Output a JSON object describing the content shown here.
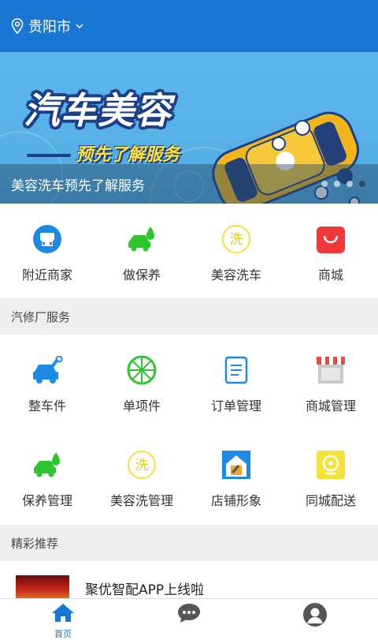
{
  "header": {
    "city": "贵阳市"
  },
  "banner": {
    "title": "汽车美容",
    "subtitle": "预先了解服务",
    "caption": "美容洗车预先了解服务",
    "dots": 4,
    "active_dot": 4
  },
  "quick_menu": [
    {
      "label": "附近商家",
      "icon": "nearby-shop-icon"
    },
    {
      "label": "做保养",
      "icon": "maintenance-icon"
    },
    {
      "label": "美容洗车",
      "icon": "car-wash-icon"
    },
    {
      "label": "商城",
      "icon": "mall-bag-icon"
    }
  ],
  "service_section": {
    "title": "汽修厂服务"
  },
  "services": [
    {
      "label": "整车件",
      "icon": "car-repair-icon"
    },
    {
      "label": "单项件",
      "icon": "wheel-icon"
    },
    {
      "label": "订单管理",
      "icon": "order-doc-icon"
    },
    {
      "label": "商城管理",
      "icon": "store-icon"
    },
    {
      "label": "保养管理",
      "icon": "maintenance-icon"
    },
    {
      "label": "美容洗管理",
      "icon": "car-wash-icon"
    },
    {
      "label": "店铺形象",
      "icon": "shop-image-icon"
    },
    {
      "label": "同城配送",
      "icon": "delivery-icon"
    }
  ],
  "recommend_section": {
    "title": "精彩推荐"
  },
  "news": [
    {
      "title": "聚优智配APP上线啦"
    }
  ],
  "tabbar": [
    {
      "label": "首页",
      "icon": "home-icon",
      "active": true
    },
    {
      "label": "消息",
      "icon": "chat-icon",
      "active": false
    },
    {
      "label": "我的",
      "icon": "profile-icon",
      "active": false
    }
  ],
  "colors": {
    "primary": "#1976d2",
    "green": "#2ec52e",
    "yellow": "#f2e23a",
    "red": "#f03a3a"
  }
}
